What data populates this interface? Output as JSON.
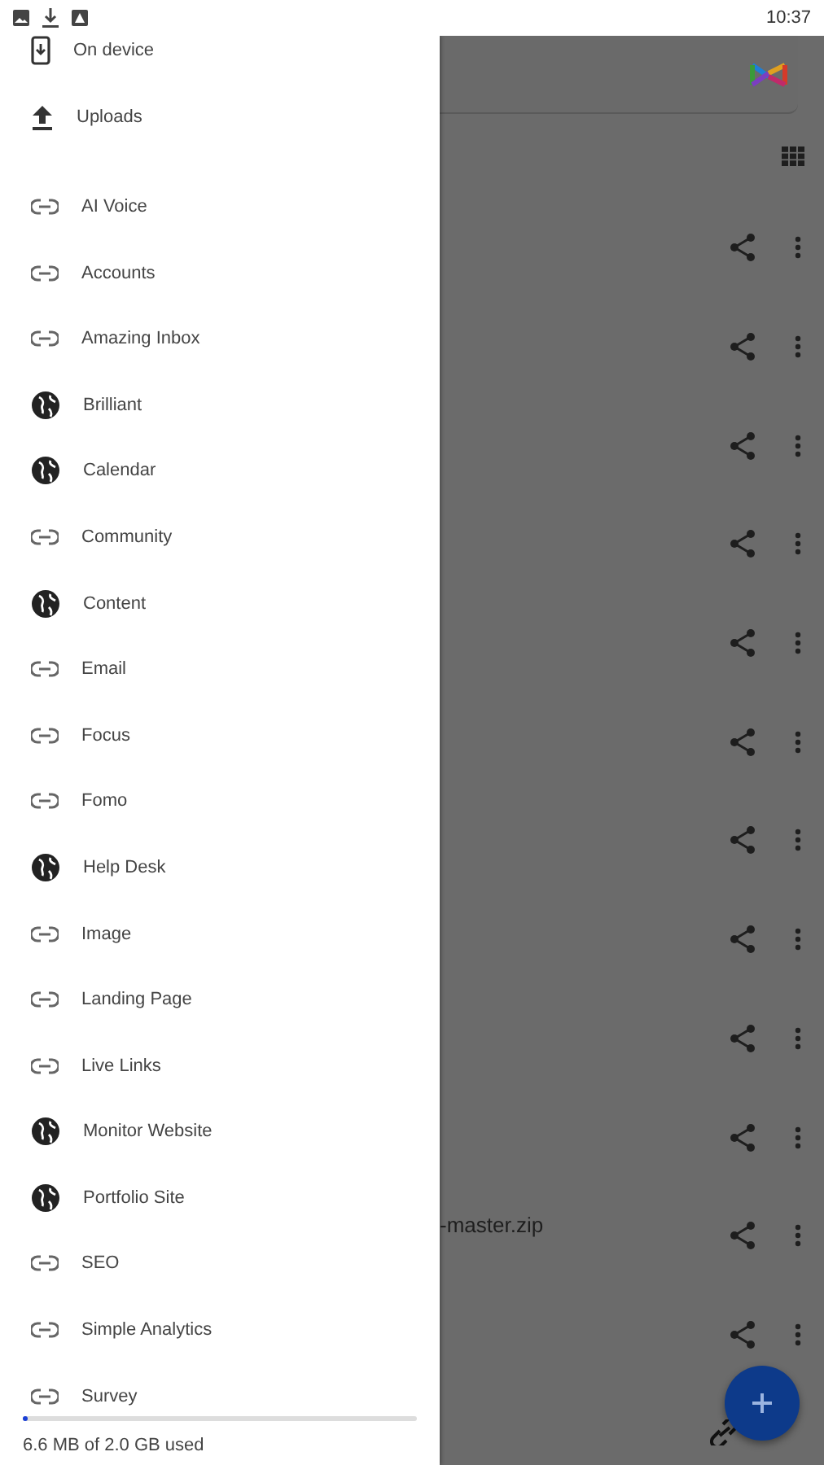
{
  "status_bar": {
    "time": "10:37"
  },
  "drawer": {
    "items": [
      {
        "label": "On device",
        "kind": "device"
      },
      {
        "label": "Uploads",
        "kind": "upload"
      },
      {
        "kind": "spacer"
      },
      {
        "label": "AI Voice",
        "kind": "link"
      },
      {
        "label": "Accounts",
        "kind": "link"
      },
      {
        "label": "Amazing Inbox",
        "kind": "link"
      },
      {
        "label": "Brilliant",
        "kind": "web"
      },
      {
        "label": "Calendar",
        "kind": "web"
      },
      {
        "label": "Community",
        "kind": "link"
      },
      {
        "label": "Content",
        "kind": "web"
      },
      {
        "label": "Email",
        "kind": "link"
      },
      {
        "label": "Focus",
        "kind": "link"
      },
      {
        "label": "Fomo",
        "kind": "link"
      },
      {
        "label": "Help Desk",
        "kind": "web"
      },
      {
        "label": "Image",
        "kind": "link"
      },
      {
        "label": "Landing Page",
        "kind": "link"
      },
      {
        "label": "Live Links",
        "kind": "link"
      },
      {
        "label": "Monitor Website",
        "kind": "web"
      },
      {
        "label": "Portfolio Site",
        "kind": "web"
      },
      {
        "label": "SEO",
        "kind": "link"
      },
      {
        "label": "Simple Analytics",
        "kind": "link"
      },
      {
        "label": "Survey",
        "kind": "link"
      }
    ],
    "storage": {
      "level": 0.004,
      "text": "6.6 MB of 2.0 GB used"
    }
  },
  "files": [
    {
      "kind": "unnamed"
    },
    {
      "kind": "unnamed"
    },
    {
      "kind": "unnamed"
    },
    {
      "kind": "unnamed"
    },
    {
      "kind": "unnamed"
    },
    {
      "kind": "unnamed"
    },
    {
      "kind": "unnamed"
    },
    {
      "kind": "unnamed"
    },
    {
      "kind": "unnamed"
    },
    {
      "kind": "unnamed"
    },
    {
      "kind": "named",
      "name": "-master.zip"
    },
    {
      "kind": "unnamed"
    }
  ]
}
